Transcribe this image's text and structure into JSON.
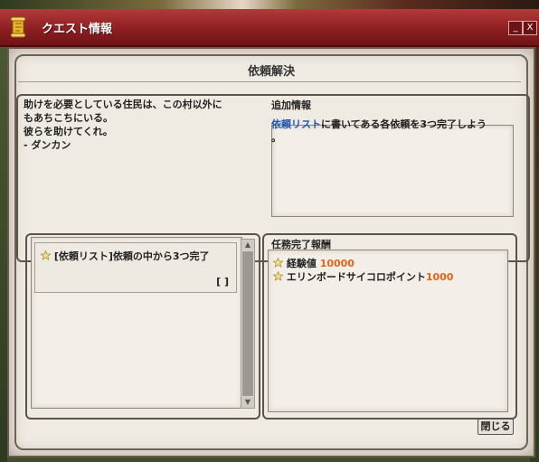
{
  "window": {
    "title": "クエスト情報",
    "minimize_label": "_",
    "close_label": "X"
  },
  "quest": {
    "title": "依頼解決",
    "description_lines": [
      "助けを必要としている住民は、この村以外に",
      "もあちこちにいる。",
      "彼らを助けてくれ。",
      "- ダンカン"
    ],
    "additional_info_label": "追加情報",
    "additional_info": {
      "highlight": "依頼リスト",
      "rest": "に書いてある各依頼を3つ完了しよう",
      "trailing": "。"
    }
  },
  "objectives": [
    {
      "text": "[依頼リスト]依頼の中から3つ完了",
      "count": "[ ]"
    }
  ],
  "rewards": {
    "label": "任務完了報酬",
    "items": [
      {
        "name": "経験値",
        "value": "10000"
      },
      {
        "name": "エリンボードサイコロポイント",
        "value": "1000"
      }
    ]
  },
  "close_button_label": "閉じる",
  "colors": {
    "title_bar": "#8e1f22",
    "highlight_blue": "#1a55b3",
    "reward_orange": "#e0641a"
  },
  "icons": [
    "scroll-icon",
    "star-icon",
    "scroll-up-arrow-icon",
    "scroll-down-arrow-icon"
  ]
}
